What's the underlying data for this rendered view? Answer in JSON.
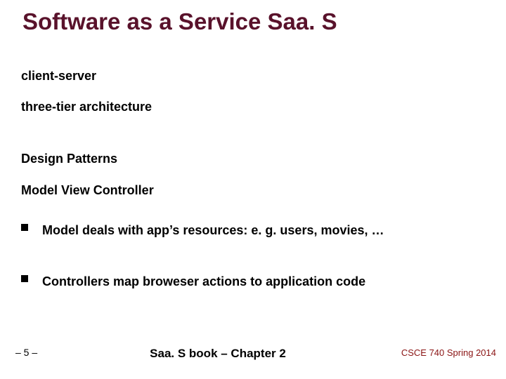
{
  "title": "Software as a Service Saa. S",
  "lines": {
    "client_server": "client-server",
    "three_tier": "three-tier architecture",
    "design_patterns": "Design Patterns",
    "mvc": "Model View Controller"
  },
  "bullets": {
    "b1": "Model deals with app’s resources: e. g. users, movies, …",
    "b2": "Controllers map broweser actions to application code"
  },
  "footer": {
    "page": "– 5 –",
    "center": "Saa. S book – Chapter 2",
    "right": "CSCE 740 Spring 2014"
  }
}
